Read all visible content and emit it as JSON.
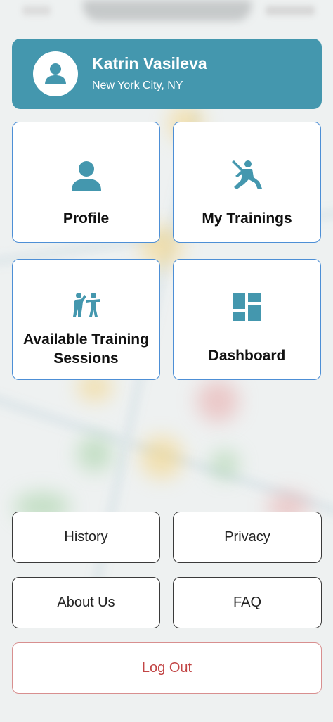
{
  "user": {
    "name": "Katrin Vasileva",
    "location": "New York City, NY",
    "avatar_icon": "user-icon"
  },
  "tiles": [
    {
      "label": "Profile",
      "icon": "person-icon"
    },
    {
      "label": "My Trainings",
      "icon": "cricket-player-icon"
    },
    {
      "label": "Available Training Sessions",
      "icon": "stretching-people-icon"
    },
    {
      "label": "Dashboard",
      "icon": "dashboard-icon"
    }
  ],
  "buttons": {
    "history": "History",
    "privacy": "Privacy",
    "about": "About Us",
    "faq": "FAQ",
    "logout": "Log Out"
  },
  "colors": {
    "accent": "#4497ae",
    "tile_border": "#4d8fd6",
    "logout_text": "#c24545",
    "logout_border": "#d88f8f"
  }
}
